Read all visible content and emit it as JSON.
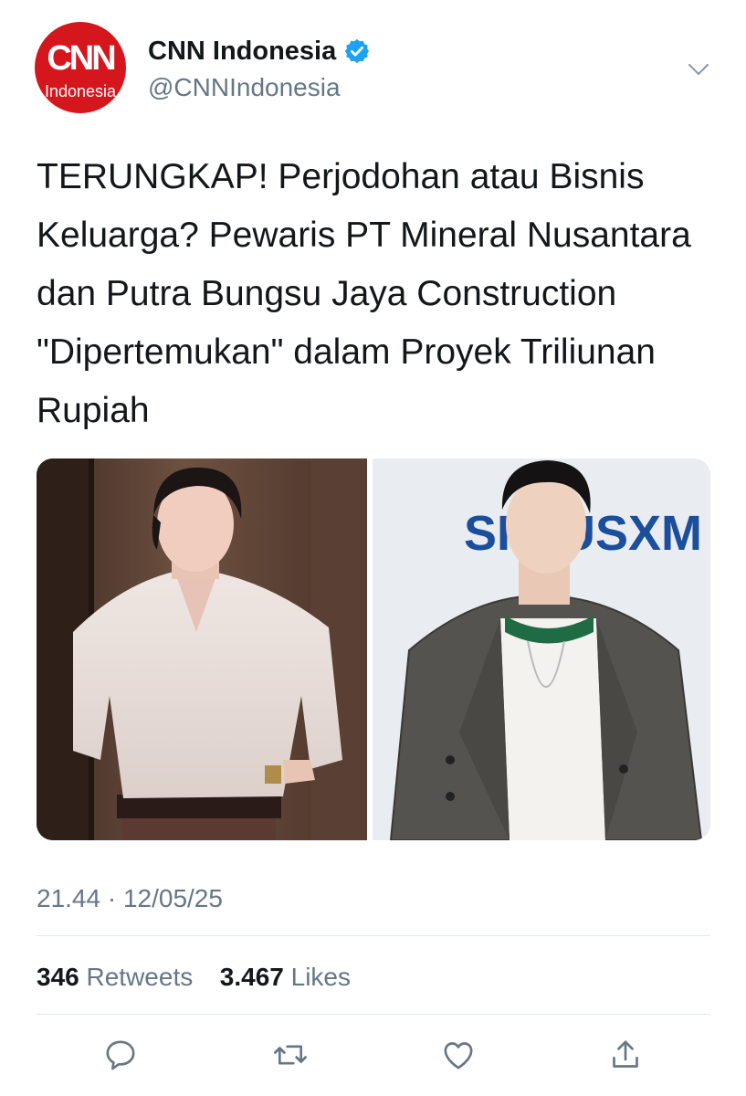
{
  "account": {
    "avatar_text_main": "CNN",
    "avatar_text_sub": "Indonesia",
    "display_name": "CNN Indonesia",
    "handle": "@CNNIndonesia",
    "verified": true,
    "brand_color": "#d5161d",
    "verified_color": "#1da1f2"
  },
  "tweet": {
    "text": "TERUNGKAP! Perjodohan atau Bisnis Keluarga? Pewaris PT Mineral Nusantara dan Putra Bungsu Jaya Construction \"Dipertemukan\" dalam Proyek Triliunan Rupiah",
    "timestamp": "21.44 · 12/05/25",
    "media": [
      {
        "icon": "photo-man-white-shirt"
      },
      {
        "icon": "photo-man-plaid-blazer",
        "backdrop_text": "SIRIUSXM"
      }
    ]
  },
  "stats": {
    "retweets_count": "346",
    "retweets_label": "Retweets",
    "likes_count": "3.467",
    "likes_label": "Likes"
  },
  "actions": [
    {
      "name": "reply-icon"
    },
    {
      "name": "retweet-icon"
    },
    {
      "name": "like-icon"
    },
    {
      "name": "share-icon"
    }
  ],
  "colors": {
    "text_primary": "#14171a",
    "text_secondary": "#657786",
    "divider": "#e1e8ed"
  }
}
